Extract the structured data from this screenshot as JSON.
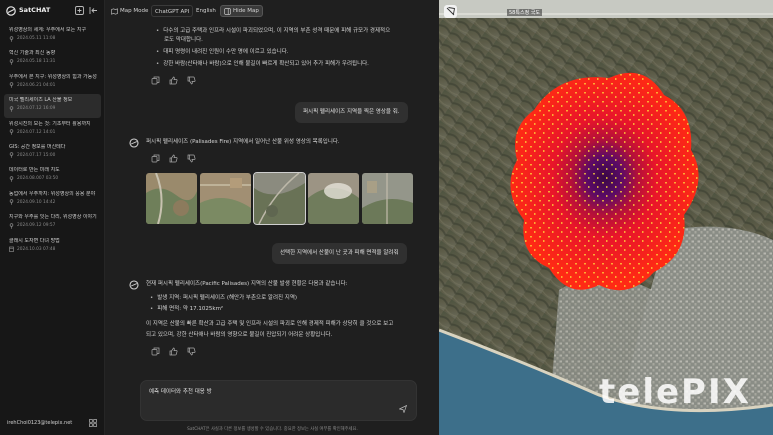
{
  "app": {
    "title": "SatCHAT"
  },
  "sidebar": {
    "chats": [
      {
        "title": "위성영상의 세계: 우주에서 보는 지구",
        "date": "2024.05.11 11:08"
      },
      {
        "title": "혁신 기술과 최신 동향",
        "date": "2024.05.18 11:31"
      },
      {
        "title": "우주에서 본 지구: 위성영상의 힘과 가능성",
        "date": "2024.06.21 04:01"
      },
      {
        "title": "미국 펠리세이즈 LA 산불 정보",
        "date": "2024.07.12 16:09"
      },
      {
        "title": "위성시진의 모든 것: 기초부터 활용까지",
        "date": "2024.07.12 14:01"
      },
      {
        "title": "GIS: 공간 정보를 머신테다",
        "date": "2024.07.17 15:00"
      },
      {
        "title": "데이터로 만든 미래 지도",
        "date": "2024.08.007 03:50"
      },
      {
        "title": "농업에서 우주까지: 위성영상의 응용 분야",
        "date": "2024.09.10 14:42"
      },
      {
        "title": "지구와 우주를 잇는 다리, 위성영상 이야기",
        "date": "2024.09.12 09:57"
      },
      {
        "title": "클래시 도자변 다녀 방법",
        "date": "2024.10.03 07:48"
      }
    ],
    "active_index": 3,
    "user_email": "irehChoi0123@telepix.net"
  },
  "topbar": {
    "map_mode": "Map Mode",
    "gpt_api": "ChatGPT API",
    "language": "English",
    "hide_map": "Hide Map"
  },
  "chat": {
    "prev_bullets": [
      "다수의 고급 주택과 인프라 시설이 파괴되었으며, 이 지역의 부촌 성격 때문에 피해 규모가 경제적으",
      "대피 명령이 내려진 인원이 수만 명에 이르고 있습니다.",
      "강한 바람(산타애나 바람)으로 인해 불길이 빠르게 확산되고 있어 추가 피해가 우려됩니다."
    ],
    "prev_bullet_cont": "로도 막대합니다.",
    "user_msg_1": "퍼시픽 펠리세이즈 지역을 찍은 영상을 줘.",
    "bot_msg_1": "퍼시픽 펠리세이즈 (Palisades Fire) 지역에서 일어난 산불 위성 영상의 목록입니다.",
    "user_msg_2": "선택한 지역에서 산불이 난 곳과 피해 면적을 알려줘",
    "bot_msg_2_intro": "현재 퍼시픽 펠리세이즈(Pacific Palisades) 지역의 산불 발생 현황은 다음과 같습니다:",
    "bot_msg_2_bullets": [
      "발생 지역: 퍼시픽 펠리세이즈 (해안가 부촌으로 알려진 지역)",
      "피해 면적: 약 17.1025km²"
    ],
    "bot_msg_2_para": [
      "이 지역은 산불의 빠른 확산과 고급 주택 및 인프라 시설의 파괴로 인해 경제적 피해가 상당히 클 것으로 보고",
      "되고 있으며, 강한 산타애나 바람의 영향으로 불길이 진압되기 어려운 상황입니다."
    ]
  },
  "input": {
    "value": "예측 데이터와 추천 대응 방"
  },
  "disclaimer": "SatCHAT은 사실과 다른 정보를 생성할 수 있습니다. 중요한 정보는 사실 여부를 확인해주세요.",
  "map": {
    "place_label": "58특스정 국도",
    "watermark": "telePIX",
    "burn_colors": {
      "outer": "#ff2a14",
      "mid": "#d8102a",
      "core": "#5a0a66",
      "spots": "#ffd83a"
    }
  }
}
